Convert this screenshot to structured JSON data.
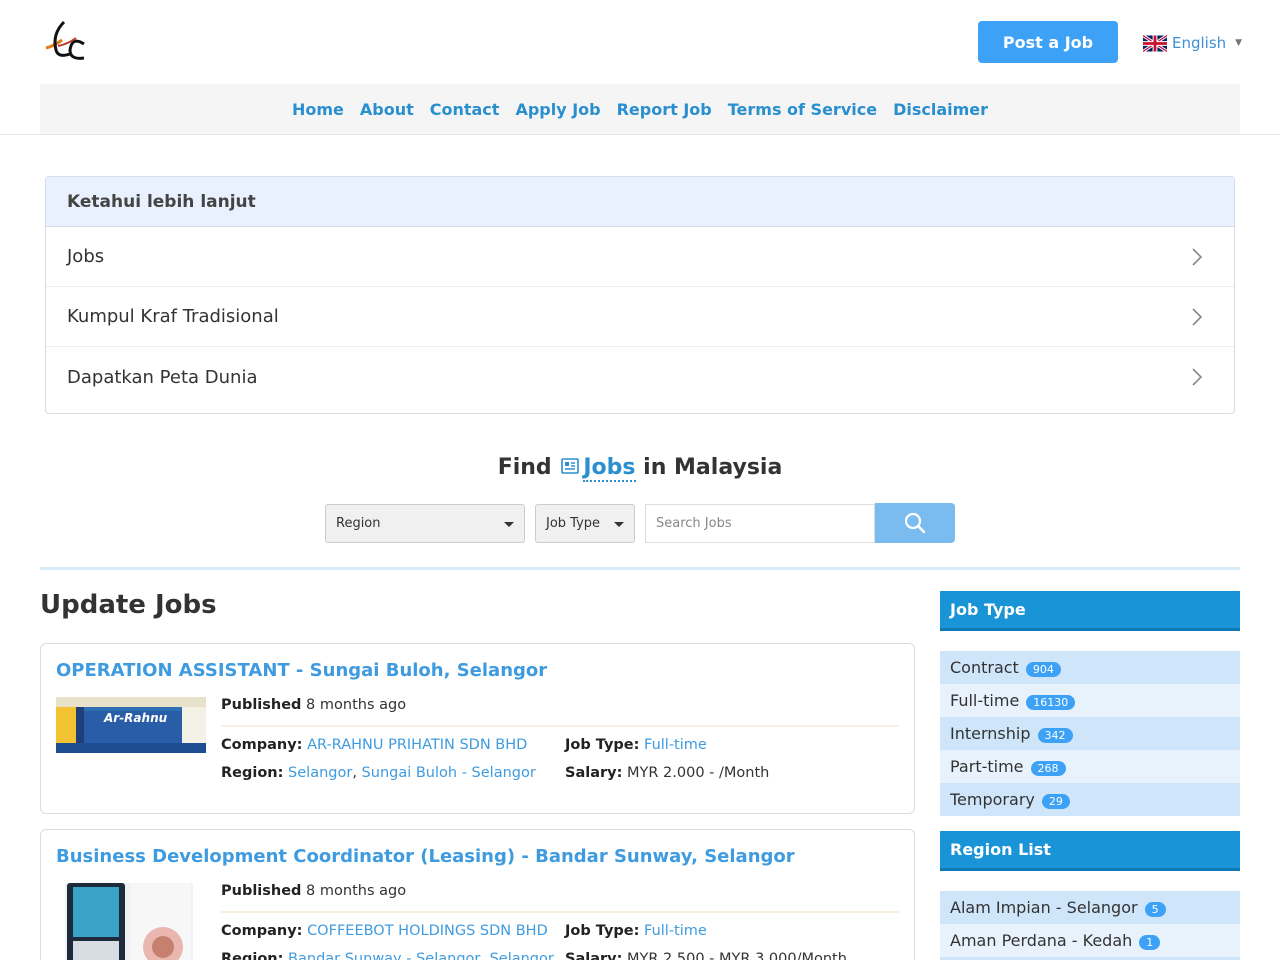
{
  "header": {
    "post_job_label": "Post a Job",
    "language_label": "English"
  },
  "nav": [
    {
      "label": "Home"
    },
    {
      "label": "About"
    },
    {
      "label": "Contact"
    },
    {
      "label": "Apply Job"
    },
    {
      "label": "Report Job"
    },
    {
      "label": "Terms of Service"
    },
    {
      "label": "Disclaimer"
    }
  ],
  "panel": {
    "title": "Ketahui lebih lanjut",
    "items": [
      {
        "label": "Jobs"
      },
      {
        "label": "Kumpul Kraf Tradisional"
      },
      {
        "label": "Dapatkan Peta Dunia"
      }
    ]
  },
  "find": {
    "prefix": "Find",
    "link": "Jobs",
    "suffix": "in Malaysia",
    "region_label": "Region",
    "job_type_label": "Job Type",
    "search_placeholder": "Search Jobs"
  },
  "main": {
    "title": "Update Jobs",
    "published_label": "Published",
    "company_label": "Company:",
    "region_label": "Region:",
    "job_type_label": "Job Type:",
    "salary_label": "Salary:",
    "jobs": [
      {
        "title": "OPERATION ASSISTANT - Sungai Buloh, Selangor",
        "published": "8 months ago",
        "company": "AR-RAHNU PRIHATIN SDN BHD",
        "region_a": "Selangor",
        "region_b": "Sungai Buloh - Selangor",
        "job_type": "Full-time",
        "salary": "MYR 2.000 - /Month",
        "thumb_text": "Ar-Rahnu"
      },
      {
        "title": "Business Development Coordinator (Leasing) - Bandar Sunway, Selangor",
        "published": "8 months ago",
        "company": "COFFEEBOT HOLDINGS SDN BHD",
        "region_a": "Bandar Sunway - Selangor",
        "region_b": "Selangor",
        "job_type": "Full-time",
        "salary": "MYR 2.500 - MYR 3.000/Month"
      }
    ]
  },
  "sidebar": {
    "job_type_title": "Job Type",
    "job_types": [
      {
        "label": "Contract",
        "count": "904"
      },
      {
        "label": "Full-time",
        "count": "16130"
      },
      {
        "label": "Internship",
        "count": "342"
      },
      {
        "label": "Part-time",
        "count": "268"
      },
      {
        "label": "Temporary",
        "count": "29"
      }
    ],
    "region_title": "Region List",
    "regions": [
      {
        "label": "Alam Impian - Selangor",
        "count": "5"
      },
      {
        "label": "Aman Perdana - Kedah",
        "count": "1"
      }
    ]
  },
  "colors": {
    "accent": "#3da2f5",
    "link": "#3e9be0",
    "sidebar_header": "#1994d6"
  }
}
